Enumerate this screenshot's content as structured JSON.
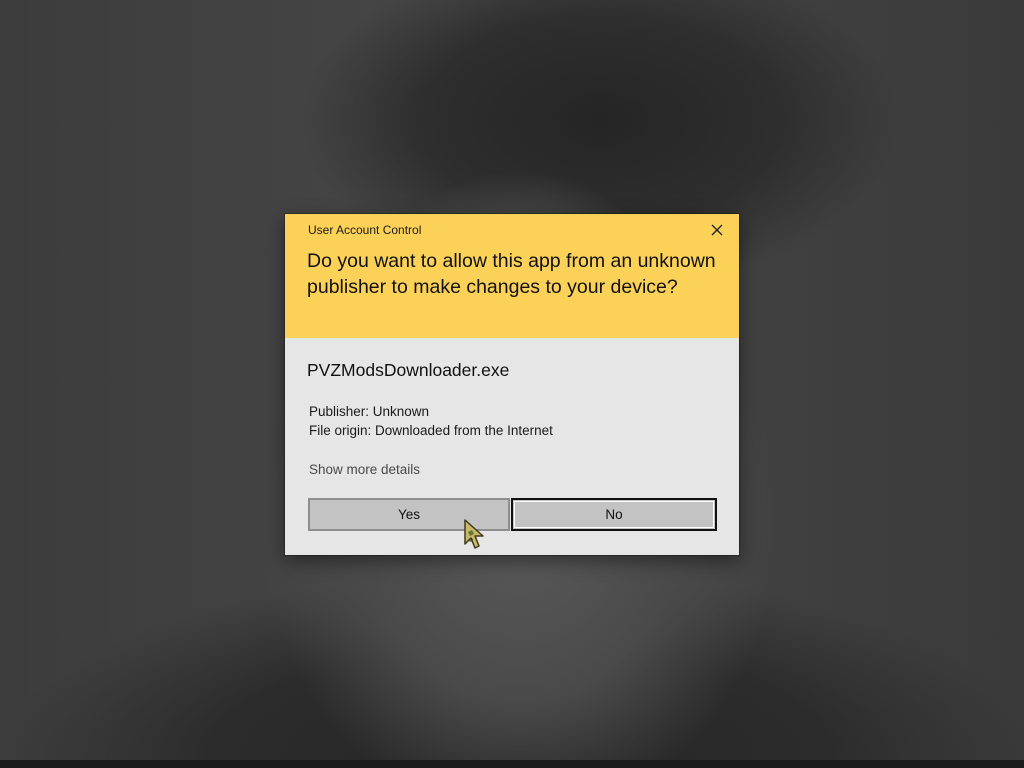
{
  "background": {
    "base_color": "#3a3a3a"
  },
  "dialog": {
    "title": "User Account Control",
    "close_icon": "close-icon",
    "header_color": "#fcd158",
    "body_color": "#e6e6e6",
    "question": "Do you want to allow this app from an unknown publisher to make changes to your device?",
    "app_name": "PVZModsDownloader.exe",
    "publisher": "Publisher: Unknown",
    "file_origin": "File origin: Downloaded from the Internet",
    "more_details_link": "Show more details",
    "buttons": {
      "yes_label": "Yes",
      "no_label": "No"
    }
  },
  "cursor": {
    "icon": "pointer-cursor-icon"
  }
}
